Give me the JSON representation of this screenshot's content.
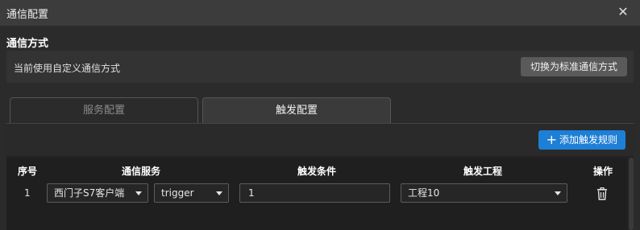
{
  "window": {
    "title": "通信配置"
  },
  "section": {
    "title": "通信方式"
  },
  "mode": {
    "current_text": "当前使用自定义通信方式",
    "switch_label": "切换为标准通信方式"
  },
  "tabs": [
    {
      "label": "服务配置",
      "active": false
    },
    {
      "label": "触发配置",
      "active": true
    }
  ],
  "toolbar": {
    "add_label": "添加触发规则",
    "add_icon": "plus-icon"
  },
  "table": {
    "headers": {
      "index": "序号",
      "service": "通信服务",
      "condition": "触发条件",
      "project": "触发工程",
      "action": "操作"
    },
    "rows": [
      {
        "index": "1",
        "service": "西门子S7客户端",
        "service_type": "trigger",
        "condition": "1",
        "project": "工程10",
        "action_icon": "trash-icon"
      }
    ]
  },
  "colors": {
    "accent": "#1e7fd6",
    "background": "#2b2b2b",
    "titlebar": "#3c3c3c"
  }
}
